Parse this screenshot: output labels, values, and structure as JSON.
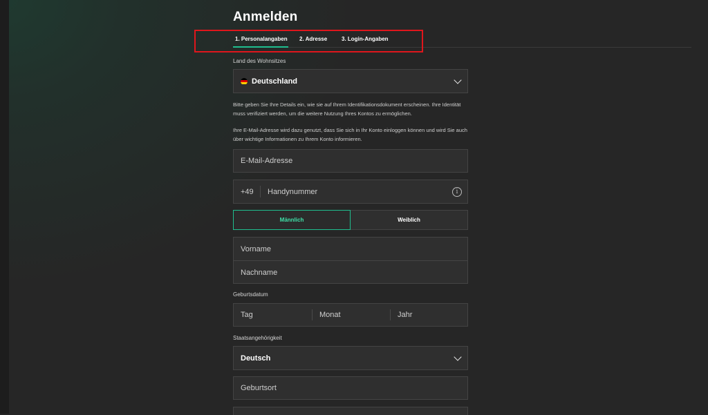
{
  "title": "Anmelden",
  "tabs": [
    {
      "label": "1. Personalangaben",
      "active": true
    },
    {
      "label": "2. Adresse",
      "active": false
    },
    {
      "label": "3. Login-Angaben",
      "active": false
    }
  ],
  "country": {
    "label": "Land des Wohnsitzes",
    "value": "Deutschland",
    "flag_colors": [
      "#000000",
      "#dd0000",
      "#ffce00"
    ]
  },
  "info_text_1": "Bitte geben Sie Ihre Details ein, wie sie auf Ihrem Identifikationsdokument erscheinen. Ihre Identität muss verifiziert werden, um die weitere Nutzung Ihres Kontos zu ermöglichen.",
  "info_text_2": "Ihre E-Mail-Adresse wird dazu genutzt, dass Sie sich in Ihr Konto einloggen können und wird Sie auch über wichtige Informationen zu Ihrem Konto informieren.",
  "email": {
    "placeholder": "E-Mail-Adresse",
    "value": ""
  },
  "phone": {
    "prefix": "+49",
    "placeholder": "Handynummer",
    "info_icon": "i"
  },
  "gender": {
    "male": "Männlich",
    "female": "Weiblich",
    "selected": "male"
  },
  "first_name": {
    "placeholder": "Vorname"
  },
  "last_name": {
    "placeholder": "Nachname"
  },
  "dob": {
    "label": "Geburtsdatum",
    "day": "Tag",
    "month": "Monat",
    "year": "Jahr"
  },
  "nationality": {
    "label": "Staatsangehörigkeit",
    "value": "Deutsch"
  },
  "birthplace": {
    "placeholder": "Geburtsort"
  },
  "colors": {
    "accent": "#1fbf8f",
    "background": "#262626",
    "field": "#2f2f2f",
    "highlight": "#e0161c"
  }
}
